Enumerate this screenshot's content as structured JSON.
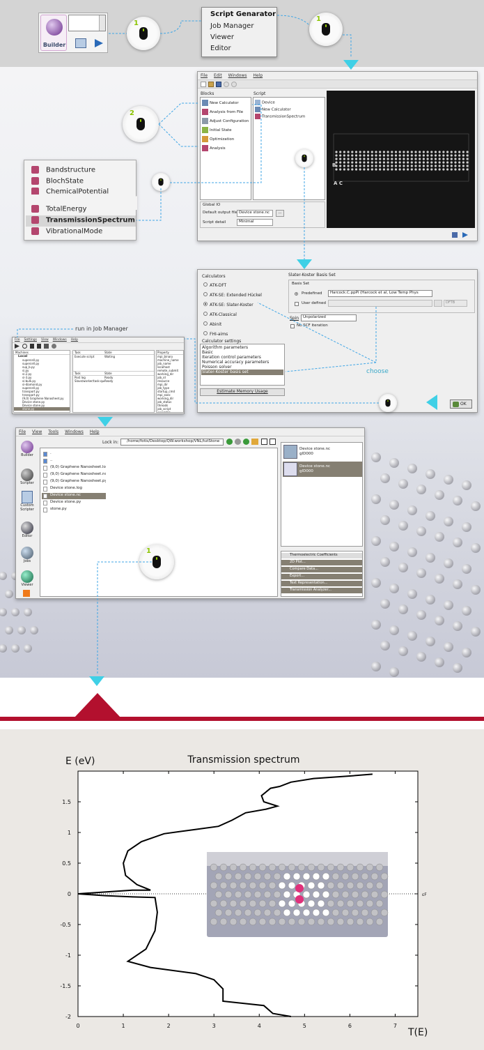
{
  "builder": {
    "label": "Builder"
  },
  "top_menu": {
    "items": [
      "Script Genarator",
      "Job Manager",
      "Viewer",
      "Editor"
    ]
  },
  "clicks": {
    "one": "1",
    "two": "2"
  },
  "script_gen": {
    "menu": [
      "File",
      "Edit",
      "Windows",
      "Help"
    ],
    "blocks_label": "Blocks",
    "blocks": [
      "New Calculator",
      "Analysis from File",
      "Adjust Configuration",
      "Initial State",
      "Optimization",
      "Analysis"
    ],
    "script_label": "Script",
    "script_items": [
      "Device",
      "New Calculator",
      "TransmissionSpectrum"
    ],
    "global_io": "Global IO",
    "default_output_label": "Default output file",
    "default_output_value": "Device stone.nc",
    "browse": "...",
    "script_detail_label": "Script detail",
    "script_detail_value": "Minimal",
    "preview_labels": {
      "b": "B",
      "ac": "A  C"
    }
  },
  "analysis_list": {
    "items": [
      "Bandstructure",
      "BlochState",
      "ChemicalPotential",
      "TotalEnergy",
      "TransmissionSpectrum",
      "VibrationalMode"
    ],
    "selected": "TransmissionSpectrum"
  },
  "calc_panel": {
    "calculators_label": "Calculators",
    "calculators": [
      "ATK-DFT",
      "ATK-SE: Extended Hückel",
      "ATK-SE: Slater-Koster",
      "ATK-Classical",
      "Abinit",
      "FHI-aims"
    ],
    "selected_calculator": "ATK-SE: Slater-Koster",
    "basis_title": "Slater-Koster Basis Set",
    "basis_set_label": "Basis Set",
    "predefined_label": "Predefined",
    "predefined_value": "Harcock.C.ppPi (Harcock et al, Low Temp Phys",
    "user_defined_label": "User defined",
    "dftb_label": "DFTB",
    "spin_label": "Spin",
    "spin_value": "Unpolarized",
    "no_scf_label": "No SCF iteration",
    "settings_label": "Calculator settings",
    "settings": [
      "Algorithm parameters",
      "Basic",
      "Iteration control parameters",
      "Numerical accuracy parameters",
      "Poisson solver",
      "Slater-Koster basis set"
    ],
    "selected_setting": "Slater-Koster basis set",
    "estimate_button": "Estimate Memory Usage",
    "ok_button": "OK"
  },
  "annotations": {
    "choose": "choose",
    "run_in_job_manager": "run in Job Manager"
  },
  "job_manager": {
    "menu": [
      "File",
      "Settings",
      "View",
      "Windows",
      "Help"
    ],
    "col_machines": "Machines",
    "machine_root": "Local",
    "files": [
      "supercell.py",
      "supercell.py",
      "sup_b.py",
      "si.py",
      "si-2.py",
      "si-3.py",
      "si-bulk.py",
      "si-diamond.py",
      "supercell.py",
      "transport.py",
      "transport.py",
      "(9,0) Graphene Nanosheet.py",
      "Device stone.py",
      "Device stone.py",
      "stone.py"
    ],
    "col_tasks": "Task",
    "col_state": "State",
    "task_rows": [
      {
        "task": "Execute script",
        "state": "Waiting"
      }
    ],
    "queue_rows": [
      {
        "task": "Post log",
        "state": "Ready"
      },
      {
        "task": "Slave/worker/task-queue.py",
        "state": "Ready"
      }
    ],
    "props_label": "Property",
    "props": [
      "mpi_binary",
      "machine_name",
      "job_name",
      "localhost",
      "remote_submit",
      "working_dir",
      "job_id",
      "resource",
      "mpi_dir",
      "job_type",
      "startup_cmd",
      "mpi_exec",
      "working_dir",
      "job_status",
      "threads",
      "job_script",
      "preamble"
    ]
  },
  "vnl": {
    "menu": [
      "File",
      "View",
      "Tools",
      "Windows",
      "Help"
    ],
    "look_in_label": "Lock in:",
    "path": "/home/fotis/Desktop/QW.workshop/VNL/tutStone",
    "sidebar": [
      "Builder",
      "Scripter",
      "Custom Scripter",
      "Editor",
      "Jobs",
      "Viewer"
    ],
    "files": [
      ".",
      "..",
      "(9,0) Graphene Nanosheet.log",
      "(9,0) Graphene Nanosheet.nc",
      "(9,0) Graphene Nanosheet.py",
      "Device stone.log",
      "Device stone.nc",
      "Device stone.py",
      "stone.py"
    ],
    "selected_file": "Device stone.nc",
    "objects": [
      {
        "name": "Device stone.nc",
        "id": "gID000"
      },
      {
        "name": "Device stone.nc",
        "id": "gID000"
      }
    ],
    "analysis_header": "Thermoelectric Coefficients",
    "analysis_items": [
      "2D Plot...",
      "Compare Data...",
      "Export...",
      "Text Representation...",
      "Transmission Analyzer..."
    ]
  },
  "chart_data": {
    "type": "line",
    "title": "Transmission spectrum",
    "ylabel": "E (eV)",
    "xlabel": "T(E)",
    "fermi_label": "εF",
    "xlim": [
      0,
      7.5
    ],
    "ylim": [
      -2,
      2
    ],
    "xticks": [
      0,
      1,
      2,
      3,
      4,
      5,
      6,
      7
    ],
    "yticks": [
      -2,
      -1.5,
      -1,
      -0.5,
      0,
      0.5,
      1,
      1.5
    ],
    "series": [
      {
        "points": [
          [
            0.0,
            0.0
          ],
          [
            0.6,
            0.03
          ],
          [
            1.2,
            0.06
          ],
          [
            1.6,
            0.06
          ],
          [
            1.3,
            0.15
          ],
          [
            1.05,
            0.3
          ],
          [
            1.0,
            0.5
          ],
          [
            1.1,
            0.7
          ],
          [
            1.4,
            0.85
          ],
          [
            1.9,
            0.98
          ],
          [
            2.6,
            1.05
          ],
          [
            3.1,
            1.1
          ],
          [
            3.4,
            1.2
          ],
          [
            3.7,
            1.32
          ],
          [
            4.15,
            1.38
          ],
          [
            4.4,
            1.43
          ],
          [
            4.1,
            1.5
          ],
          [
            4.05,
            1.6
          ],
          [
            4.25,
            1.72
          ],
          [
            4.45,
            1.75
          ],
          [
            4.7,
            1.82
          ],
          [
            5.2,
            1.88
          ],
          [
            6.0,
            1.92
          ],
          [
            6.5,
            1.95
          ],
          [
            0.6,
            -0.03
          ],
          [
            1.2,
            -0.05
          ],
          [
            1.7,
            -0.06
          ],
          [
            1.75,
            -0.3
          ],
          [
            1.7,
            -0.6
          ],
          [
            1.5,
            -0.9
          ],
          [
            1.1,
            -1.1
          ],
          [
            1.6,
            -1.2
          ],
          [
            2.6,
            -1.3
          ],
          [
            3.0,
            -1.4
          ],
          [
            3.2,
            -1.55
          ],
          [
            3.2,
            -1.75
          ],
          [
            4.1,
            -1.82
          ],
          [
            4.3,
            -1.95
          ],
          [
            4.7,
            -2.0
          ]
        ],
        "upper": [
          [
            0.0,
            0.0
          ],
          [
            0.6,
            0.03
          ],
          [
            1.2,
            0.06
          ],
          [
            1.6,
            0.06
          ],
          [
            1.3,
            0.15
          ],
          [
            1.05,
            0.3
          ],
          [
            1.0,
            0.5
          ],
          [
            1.1,
            0.7
          ],
          [
            1.4,
            0.85
          ],
          [
            1.9,
            0.98
          ],
          [
            2.6,
            1.05
          ],
          [
            3.1,
            1.1
          ],
          [
            3.4,
            1.2
          ],
          [
            3.7,
            1.32
          ],
          [
            4.15,
            1.38
          ],
          [
            4.4,
            1.43
          ],
          [
            4.1,
            1.5
          ],
          [
            4.05,
            1.6
          ],
          [
            4.25,
            1.72
          ],
          [
            4.45,
            1.75
          ],
          [
            4.7,
            1.82
          ],
          [
            5.2,
            1.88
          ],
          [
            6.0,
            1.92
          ],
          [
            6.5,
            1.95
          ]
        ],
        "lower": [
          [
            0.0,
            0.0
          ],
          [
            0.6,
            -0.03
          ],
          [
            1.2,
            -0.05
          ],
          [
            1.7,
            -0.06
          ],
          [
            1.75,
            -0.3
          ],
          [
            1.7,
            -0.6
          ],
          [
            1.5,
            -0.9
          ],
          [
            1.1,
            -1.1
          ],
          [
            1.6,
            -1.2
          ],
          [
            2.6,
            -1.3
          ],
          [
            3.0,
            -1.4
          ],
          [
            3.2,
            -1.55
          ],
          [
            3.2,
            -1.75
          ],
          [
            4.1,
            -1.82
          ],
          [
            4.3,
            -1.95
          ],
          [
            4.7,
            -2.0
          ]
        ]
      }
    ]
  },
  "colors": {
    "accent_cyan": "#3fd0e6",
    "brand_red": "#b3102e",
    "selection": "#857f72",
    "click_green": "#8bc400"
  }
}
